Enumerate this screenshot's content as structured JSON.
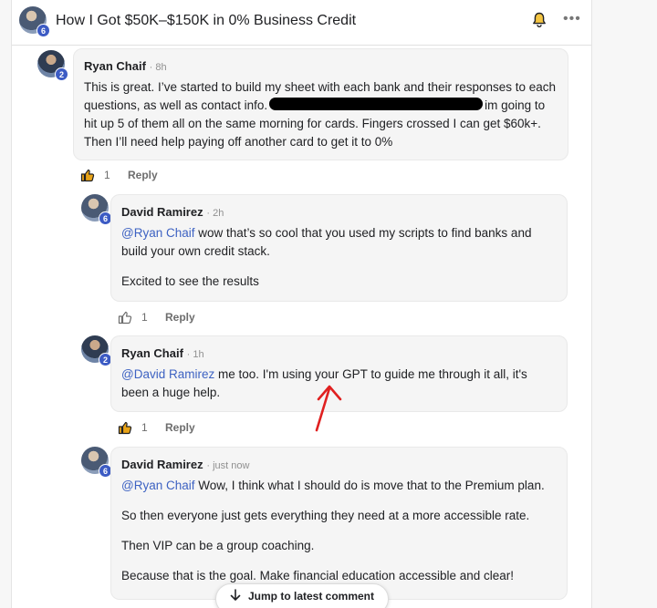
{
  "header": {
    "title": "How I Got $50K–$150K in 0% Business Credit",
    "avatar_level": "6"
  },
  "comments": [
    {
      "author": "Ryan Chaif",
      "time": "· 8h",
      "level": "2",
      "text_before": "This is great. I’ve started to build my sheet with each bank and their responses to each questions, as well as contact info.",
      "text_after": "im going to hit up 5 of them all on the same morning for cards. Fingers crossed I can get $60k+. Then I’ll need help paying off another card to get it to 0%",
      "likes": "1",
      "liked": true,
      "reply_label": "Reply"
    },
    {
      "author": "David Ramirez",
      "time": "· 2h",
      "level": "6",
      "mention": "@Ryan Chaif",
      "text": "wow that’s so cool that you used my scripts to find banks and build your own credit stack.",
      "text2": "Excited to see the results",
      "likes": "1",
      "liked": false,
      "reply_label": "Reply"
    },
    {
      "author": "Ryan Chaif",
      "time": "· 1h",
      "level": "2",
      "mention": "@David Ramirez",
      "text": "me too. I'm using your GPT to guide me through it all, it's been a huge help.",
      "likes": "1",
      "liked": true,
      "reply_label": "Reply"
    },
    {
      "author": "David Ramirez",
      "time": "· just now",
      "level": "6",
      "mention": "@Ryan Chaif",
      "text": "Wow, I think what I should do is move that to the Premium plan.",
      "text2": "So then everyone just gets everything they need at a more accessible rate.",
      "text3": "Then VIP can be a group coaching.",
      "text4": "Because that is the goal. Make financial education accessible and clear!"
    }
  ],
  "jump_button": {
    "label": "Jump to latest comment"
  },
  "icons": {
    "bell": "bell-icon",
    "more": "more-horizontal-icon",
    "like": "thumbs-up-icon",
    "arrow": "arrow-down-icon"
  },
  "colors": {
    "accent": "#3d62c2",
    "liked": "#e8a317",
    "level_badge": "#3c5bc4",
    "annotation": "#e02020"
  }
}
